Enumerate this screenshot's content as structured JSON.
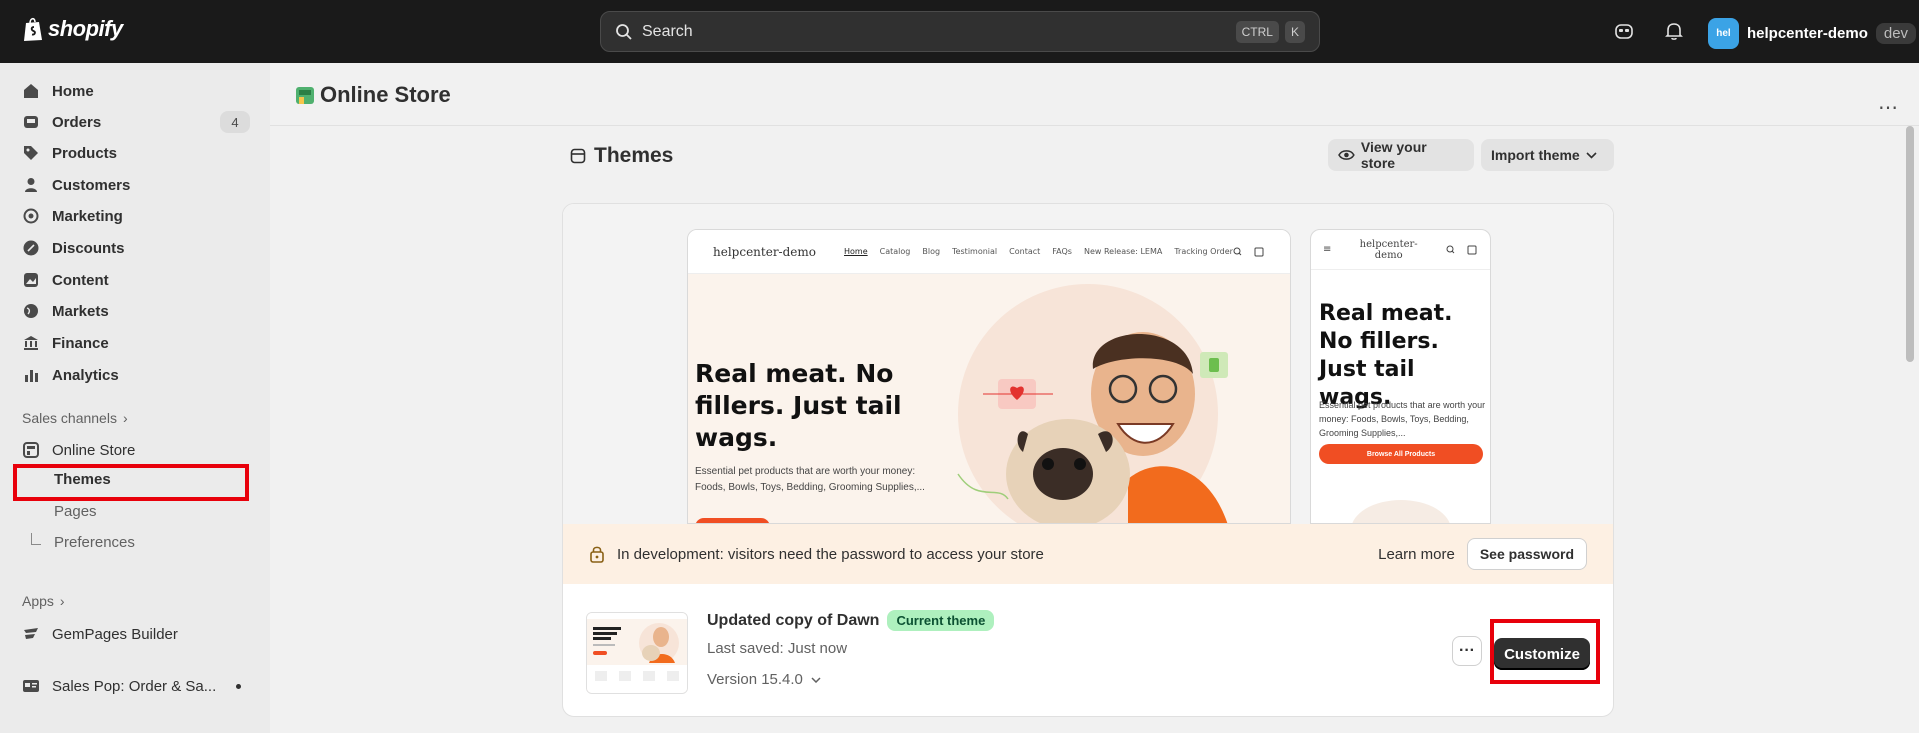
{
  "topbar": {
    "brand": "shopify",
    "search_placeholder": "Search",
    "shortcut_keys": [
      "CTRL",
      "K"
    ],
    "account": {
      "avatar_text": "hel",
      "name": "helpcenter-demo",
      "tag": "dev"
    }
  },
  "sidebar": {
    "items": [
      {
        "label": "Home",
        "icon": "home-icon"
      },
      {
        "label": "Orders",
        "icon": "inbox-icon",
        "badge": "4"
      },
      {
        "label": "Products",
        "icon": "tag-icon"
      },
      {
        "label": "Customers",
        "icon": "person-icon"
      },
      {
        "label": "Marketing",
        "icon": "target-icon"
      },
      {
        "label": "Discounts",
        "icon": "discount-icon"
      },
      {
        "label": "Content",
        "icon": "content-icon"
      },
      {
        "label": "Markets",
        "icon": "globe-icon"
      },
      {
        "label": "Finance",
        "icon": "bank-icon"
      },
      {
        "label": "Analytics",
        "icon": "chart-icon"
      }
    ],
    "sales_channels": {
      "title": "Sales channels",
      "online_store": "Online Store",
      "sub_items": [
        "Themes",
        "Pages",
        "Preferences"
      ]
    },
    "apps": {
      "title": "Apps",
      "items": [
        "GemPages Builder",
        "Sales Pop: Order & Sa..."
      ]
    }
  },
  "page": {
    "title": "Online Store",
    "section_title": "Themes",
    "view_store": "View your store",
    "import_theme": "Import theme"
  },
  "preview": {
    "desktop": {
      "brand": "helpcenter-demo",
      "links": [
        "Home",
        "Catalog",
        "Blog",
        "Testimonial",
        "Contact",
        "FAQs",
        "New Release: LEMA",
        "Tracking Order"
      ],
      "headline": "Real meat. No fillers. Just tail wags.",
      "body": "Essential pet products that are worth your money: Foods, Bowls, Toys, Bedding, Grooming Supplies,..."
    },
    "mobile": {
      "brand": "helpcenter-demo",
      "headline": "Real meat. No fillers. Just tail wags.",
      "body": "Essential pet products that are worth your money: Foods, Bowls, Toys, Bedding, Grooming Supplies,...",
      "button": "Browse All Products"
    }
  },
  "dev_banner": {
    "message": "In development: visitors need the password to access your store",
    "learn_more": "Learn more",
    "see_password": "See password"
  },
  "theme": {
    "name": "Updated copy of Dawn",
    "badge": "Current theme",
    "last_saved": "Last saved: Just now",
    "version": "Version 15.4.0",
    "customize": "Customize"
  },
  "colors": {
    "topbar": "#1a1a1a",
    "accent_orange": "#f04e23",
    "current_badge_bg": "#aef0be",
    "highlight": "#e8000b"
  }
}
